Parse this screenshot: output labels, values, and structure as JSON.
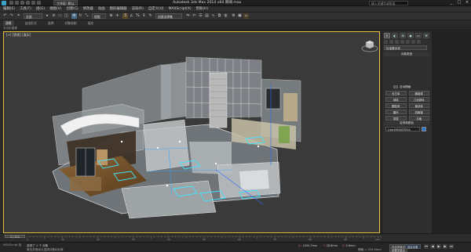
{
  "window": {
    "title": "Autodesk 3ds Max  2014 x64     新闻.max",
    "workspace": "工作区: 默认",
    "search_placeholder": "键入关键字或短语",
    "controls": [
      "_",
      "□",
      "×"
    ]
  },
  "menubar": {
    "items": [
      "编辑(E)",
      "工具(T)",
      "组(G)",
      "视图(V)",
      "创建(C)",
      "修改器",
      "动画",
      "图形编辑器",
      "渲染(R)",
      "自定义(U)",
      "MAXScript(X)",
      "帮助(H)"
    ]
  },
  "main_toolbar": {
    "filter": "全部",
    "view": "视图",
    "selection_set": "创建选择集"
  },
  "ribbon": {
    "tabs": [
      "建模",
      "自由形式",
      "选择",
      "对象绘制",
      "填充"
    ],
    "active_tab": "建模",
    "sub_label": "多边形建模"
  },
  "viewport": {
    "label": "[+] [透视] [真实]",
    "border_color": "#e8c23a"
  },
  "command_panel": {
    "tabs": [
      "create",
      "modify",
      "hierarchy",
      "motion",
      "display",
      "utilities"
    ],
    "dropdown": "标准基本体",
    "object_type_title": "对象类型",
    "autogrid_label": "自动栅格",
    "buttons": [
      "长方体",
      "圆锥体",
      "球体",
      "几何球体",
      "圆柱体",
      "管状体",
      "圆环",
      "四棱锥",
      "茶壶",
      "平面"
    ],
    "name_color_title": "名称和颜色",
    "name_value": "Line1950037014",
    "swatch_color": "#2c73d6"
  },
  "timeline": {
    "frame": "0 / 100",
    "tick_labels": [
      "0",
      "10",
      "20",
      "30",
      "40",
      "50",
      "60",
      "70",
      "80",
      "90",
      "100"
    ]
  },
  "statusbar": {
    "selection": "选择了 1 个 对象",
    "prompt": "单击并拖动以选择并移动对象",
    "script_label": "MAXScript 迷",
    "x_label": "X:",
    "x_value": "-1054.7mm",
    "y_label": "Y:",
    "y_value": "28.8mm",
    "z_label": "Z:",
    "z_value": "0.0mm",
    "grid": "栅格 = 254.0mm",
    "auto_key": "自动关键点",
    "set_key": "设置关键点",
    "selected": "选定对象",
    "key_filters": "关键点过滤器...",
    "time_tag": "添加时间标记"
  }
}
